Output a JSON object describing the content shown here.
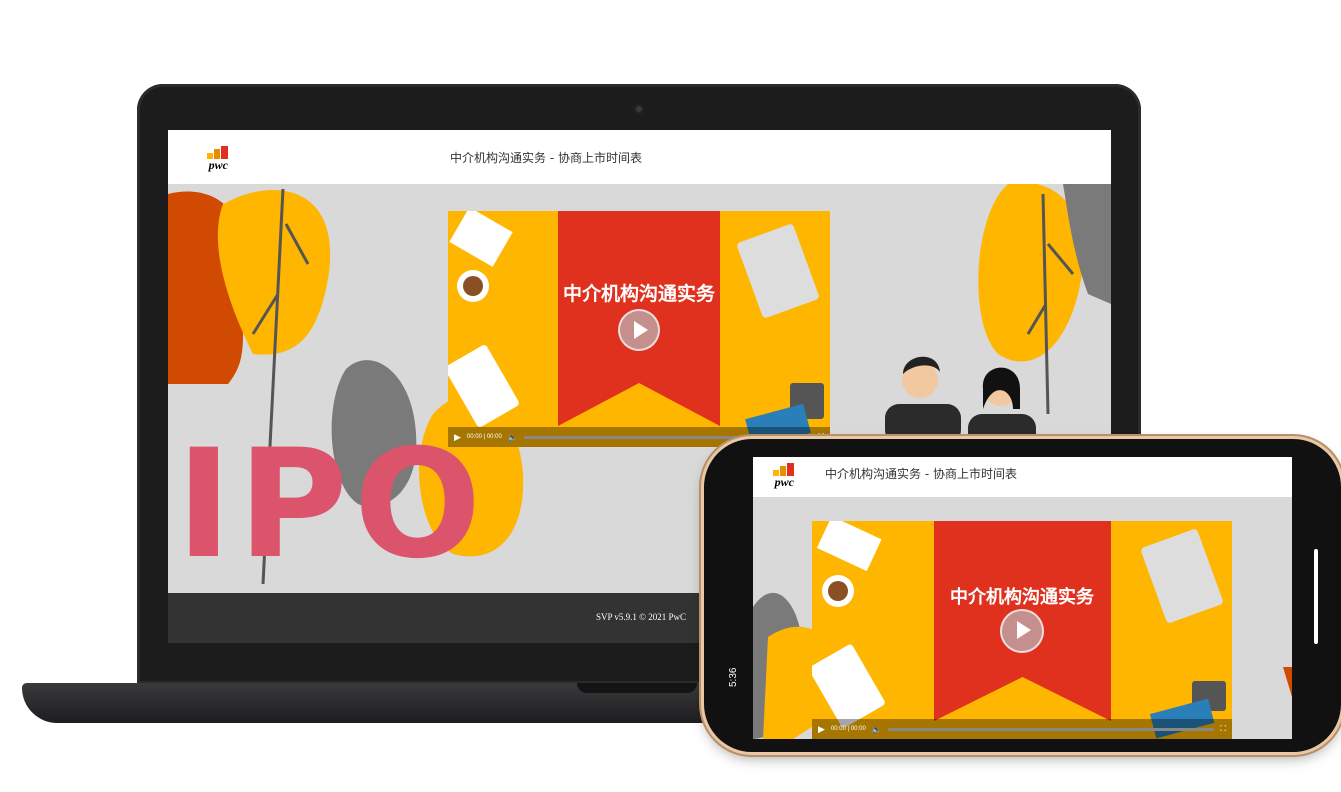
{
  "app": {
    "title": "中介机构沟通实务 - 协商上市时间表",
    "logo_text": "pwc",
    "footer": "SVP v5.9.1 © 2021 PwC",
    "hero_text": "IPO"
  },
  "video": {
    "title": "中介机构沟通实务",
    "time": "00:00 | 00:00"
  },
  "phone": {
    "status_time": "5:36"
  },
  "colors": {
    "pwc_yellow": "#ffb600",
    "pwc_orange": "#eb8c00",
    "pwc_red": "#e0301e",
    "ipo_pink": "#db546c",
    "footer_bg": "#333333"
  }
}
